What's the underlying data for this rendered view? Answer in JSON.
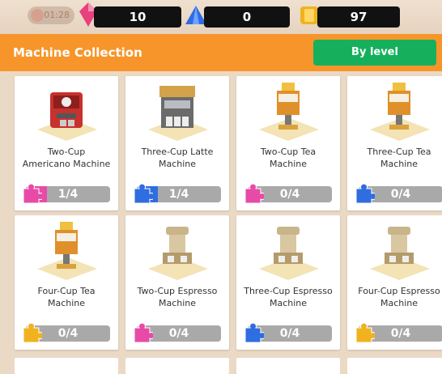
{
  "top_bar": {
    "timer": "01:28",
    "gems": "10",
    "crystals": "0",
    "coins": "97",
    "colors": {
      "gem": "#e8417e",
      "crystal": "#2f6de0",
      "coin": "#f0b21f"
    }
  },
  "header": {
    "title": "Machine Collection",
    "sort_button": "By level",
    "colors": {
      "header": "#f7952a",
      "button": "#16b05d"
    }
  },
  "machines": [
    {
      "name_line1": "Two-Cup",
      "name_line2": "Americano Machine",
      "progress": "1/4",
      "fraction": 0.25,
      "puzzle": "#e84aa8",
      "kind": "americano"
    },
    {
      "name_line1": "Three-Cup Latte",
      "name_line2": "Machine",
      "progress": "1/4",
      "fraction": 0.25,
      "puzzle": "#2f6de0",
      "kind": "latte"
    },
    {
      "name_line1": "Two-Cup Tea",
      "name_line2": "Machine",
      "progress": "0/4",
      "fraction": 0,
      "puzzle": "#e84aa8",
      "kind": "tea"
    },
    {
      "name_line1": "Three-Cup Tea",
      "name_line2": "Machine",
      "progress": "0/4",
      "fraction": 0,
      "puzzle": "#2f6de0",
      "kind": "tea"
    },
    {
      "name_line1": "Four-Cup Tea",
      "name_line2": "Machine",
      "progress": "0/4",
      "fraction": 0,
      "puzzle": "#f0b21f",
      "kind": "tea"
    },
    {
      "name_line1": "Two-Cup Espresso",
      "name_line2": "Machine",
      "progress": "0/4",
      "fraction": 0,
      "puzzle": "#e84aa8",
      "kind": "espresso"
    },
    {
      "name_line1": "Three-Cup Espresso",
      "name_line2": "Machine",
      "progress": "0/4",
      "fraction": 0,
      "puzzle": "#2f6de0",
      "kind": "espresso"
    },
    {
      "name_line1": "Four-Cup Espresso",
      "name_line2": "Machine",
      "progress": "0/4",
      "fraction": 0,
      "puzzle": "#f0b21f",
      "kind": "espresso"
    }
  ]
}
